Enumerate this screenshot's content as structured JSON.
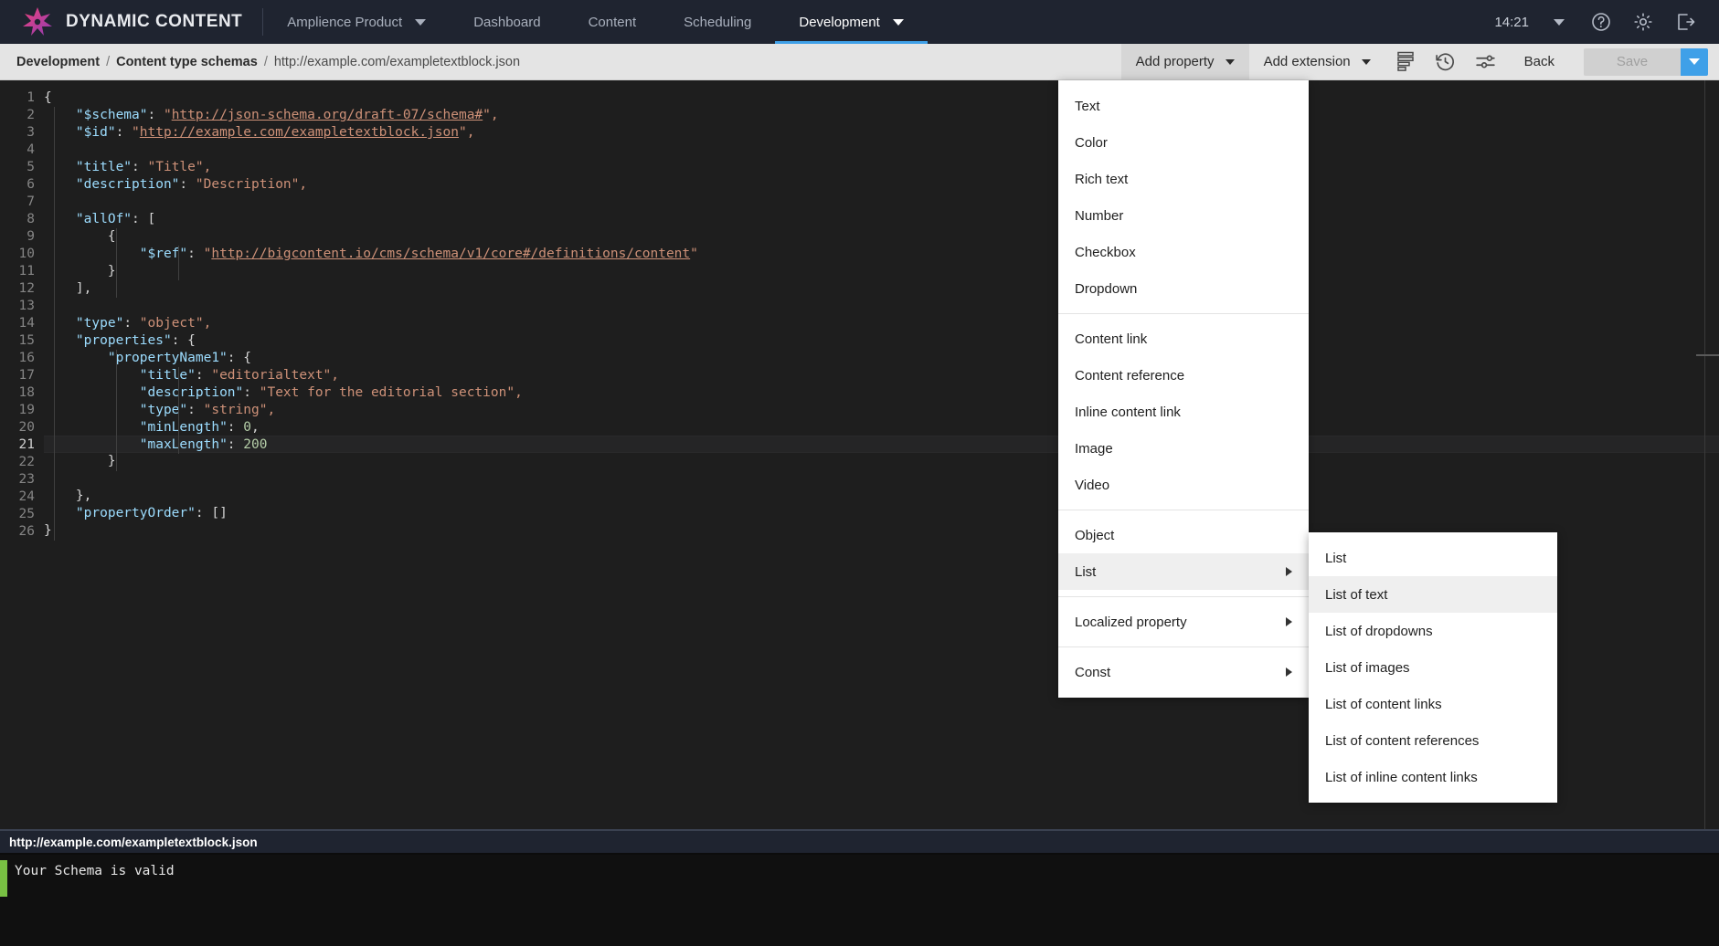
{
  "topnav": {
    "brand": "DYNAMIC CONTENT",
    "logo_icon": "amplience-star-logo",
    "product_selector": {
      "label": "Amplience Product",
      "icon": "chevron-down-icon"
    },
    "items": [
      {
        "label": "Dashboard",
        "active": false
      },
      {
        "label": "Content",
        "active": false
      },
      {
        "label": "Scheduling",
        "active": false
      },
      {
        "label": "Development",
        "active": true,
        "icon": "chevron-down-icon"
      }
    ],
    "time": "14:21",
    "time_caret_icon": "chevron-down-icon",
    "help_icon": "help-circle-icon",
    "settings_icon": "gear-icon",
    "logout_icon": "logout-icon"
  },
  "toolbar": {
    "breadcrumb": [
      {
        "label": "Development",
        "link": true
      },
      {
        "label": "Content type schemas",
        "link": true
      },
      {
        "label": "http://example.com/exampletextblock.json",
        "link": false
      }
    ],
    "breadcrumb_separator": "/",
    "add_property": {
      "label": "Add property",
      "icon": "chevron-down-icon",
      "pressed": true
    },
    "add_extension": {
      "label": "Add extension",
      "icon": "chevron-down-icon",
      "pressed": false
    },
    "icons": [
      {
        "name": "format-lines-icon"
      },
      {
        "name": "history-clock-icon"
      },
      {
        "name": "settings-sliders-icon"
      }
    ],
    "back_label": "Back",
    "save_label": "Save",
    "save_disabled": true,
    "save_dropdown_icon": "chevron-down-icon",
    "accent_color": "#3fa0e8"
  },
  "editor": {
    "language": "json",
    "active_line": 21,
    "total_lines": 26,
    "lines": [
      {
        "n": 1,
        "tokens": [
          {
            "t": "{",
            "c": "p"
          }
        ]
      },
      {
        "n": 2,
        "tokens": [
          {
            "t": "    ",
            "c": "p"
          },
          {
            "t": "\"$schema\"",
            "c": "k"
          },
          {
            "t": ": ",
            "c": "p"
          },
          {
            "t": "\"",
            "c": "s"
          },
          {
            "t": "http://json-schema.org/draft-07/schema#",
            "c": "u"
          },
          {
            "t": "\",",
            "c": "s"
          }
        ]
      },
      {
        "n": 3,
        "tokens": [
          {
            "t": "    ",
            "c": "p"
          },
          {
            "t": "\"$id\"",
            "c": "k"
          },
          {
            "t": ": ",
            "c": "p"
          },
          {
            "t": "\"",
            "c": "s"
          },
          {
            "t": "http://example.com/exampletextblock.json",
            "c": "u"
          },
          {
            "t": "\",",
            "c": "s"
          }
        ]
      },
      {
        "n": 4,
        "tokens": []
      },
      {
        "n": 5,
        "tokens": [
          {
            "t": "    ",
            "c": "p"
          },
          {
            "t": "\"title\"",
            "c": "k"
          },
          {
            "t": ": ",
            "c": "p"
          },
          {
            "t": "\"Title\",",
            "c": "s"
          }
        ]
      },
      {
        "n": 6,
        "tokens": [
          {
            "t": "    ",
            "c": "p"
          },
          {
            "t": "\"description\"",
            "c": "k"
          },
          {
            "t": ": ",
            "c": "p"
          },
          {
            "t": "\"Description\",",
            "c": "s"
          }
        ]
      },
      {
        "n": 7,
        "tokens": []
      },
      {
        "n": 8,
        "tokens": [
          {
            "t": "    ",
            "c": "p"
          },
          {
            "t": "\"allOf\"",
            "c": "k"
          },
          {
            "t": ": [",
            "c": "p"
          }
        ]
      },
      {
        "n": 9,
        "tokens": [
          {
            "t": "        {",
            "c": "p"
          }
        ]
      },
      {
        "n": 10,
        "tokens": [
          {
            "t": "            ",
            "c": "p"
          },
          {
            "t": "\"$ref\"",
            "c": "k"
          },
          {
            "t": ": ",
            "c": "p"
          },
          {
            "t": "\"",
            "c": "s"
          },
          {
            "t": "http://bigcontent.io/cms/schema/v1/core#/definitions/content",
            "c": "u"
          },
          {
            "t": "\"",
            "c": "s"
          }
        ]
      },
      {
        "n": 11,
        "tokens": [
          {
            "t": "        }",
            "c": "p"
          }
        ]
      },
      {
        "n": 12,
        "tokens": [
          {
            "t": "    ],",
            "c": "p"
          }
        ]
      },
      {
        "n": 13,
        "tokens": []
      },
      {
        "n": 14,
        "tokens": [
          {
            "t": "    ",
            "c": "p"
          },
          {
            "t": "\"type\"",
            "c": "k"
          },
          {
            "t": ": ",
            "c": "p"
          },
          {
            "t": "\"object\",",
            "c": "s"
          }
        ]
      },
      {
        "n": 15,
        "tokens": [
          {
            "t": "    ",
            "c": "p"
          },
          {
            "t": "\"properties\"",
            "c": "k"
          },
          {
            "t": ": {",
            "c": "p"
          }
        ]
      },
      {
        "n": 16,
        "tokens": [
          {
            "t": "        ",
            "c": "p"
          },
          {
            "t": "\"propertyName1\"",
            "c": "k"
          },
          {
            "t": ": {",
            "c": "p"
          }
        ]
      },
      {
        "n": 17,
        "tokens": [
          {
            "t": "            ",
            "c": "p"
          },
          {
            "t": "\"title\"",
            "c": "k"
          },
          {
            "t": ": ",
            "c": "p"
          },
          {
            "t": "\"editorialtext\",",
            "c": "s"
          }
        ]
      },
      {
        "n": 18,
        "tokens": [
          {
            "t": "            ",
            "c": "p"
          },
          {
            "t": "\"description\"",
            "c": "k"
          },
          {
            "t": ": ",
            "c": "p"
          },
          {
            "t": "\"Text for the editorial section\",",
            "c": "s"
          }
        ]
      },
      {
        "n": 19,
        "tokens": [
          {
            "t": "            ",
            "c": "p"
          },
          {
            "t": "\"type\"",
            "c": "k"
          },
          {
            "t": ": ",
            "c": "p"
          },
          {
            "t": "\"string\",",
            "c": "s"
          }
        ]
      },
      {
        "n": 20,
        "tokens": [
          {
            "t": "            ",
            "c": "p"
          },
          {
            "t": "\"minLength\"",
            "c": "k"
          },
          {
            "t": ": ",
            "c": "p"
          },
          {
            "t": "0",
            "c": "n"
          },
          {
            "t": ",",
            "c": "p"
          }
        ]
      },
      {
        "n": 21,
        "tokens": [
          {
            "t": "            ",
            "c": "p"
          },
          {
            "t": "\"maxLength\"",
            "c": "k"
          },
          {
            "t": ": ",
            "c": "p"
          },
          {
            "t": "200",
            "c": "n"
          }
        ]
      },
      {
        "n": 22,
        "tokens": [
          {
            "t": "        }",
            "c": "p"
          }
        ]
      },
      {
        "n": 23,
        "tokens": []
      },
      {
        "n": 24,
        "tokens": [
          {
            "t": "    },",
            "c": "p"
          }
        ]
      },
      {
        "n": 25,
        "tokens": [
          {
            "t": "    ",
            "c": "p"
          },
          {
            "t": "\"propertyOrder\"",
            "c": "k"
          },
          {
            "t": ": []",
            "c": "p"
          }
        ]
      },
      {
        "n": 26,
        "tokens": [
          {
            "t": "}",
            "c": "p"
          }
        ]
      }
    ]
  },
  "status": {
    "url": "http://example.com/exampletextblock.json",
    "message": "Your Schema is valid",
    "valid_color": "#78c043"
  },
  "menu_main": {
    "items": [
      {
        "label": "Text"
      },
      {
        "label": "Color"
      },
      {
        "label": "Rich text"
      },
      {
        "label": "Number"
      },
      {
        "label": "Checkbox"
      },
      {
        "label": "Dropdown"
      },
      {
        "divider": true
      },
      {
        "label": "Content link"
      },
      {
        "label": "Content reference"
      },
      {
        "label": "Inline content link"
      },
      {
        "label": "Image"
      },
      {
        "label": "Video"
      },
      {
        "divider": true
      },
      {
        "label": "Object"
      },
      {
        "label": "List",
        "submenu": true,
        "highlighted": true,
        "icon": "chevron-right-icon"
      },
      {
        "divider": true
      },
      {
        "label": "Localized property",
        "submenu": true,
        "icon": "chevron-right-icon"
      },
      {
        "divider": true
      },
      {
        "label": "Const",
        "submenu": true,
        "icon": "chevron-right-icon"
      }
    ]
  },
  "menu_sub": {
    "items": [
      {
        "label": "List"
      },
      {
        "label": "List of text",
        "highlighted": true
      },
      {
        "label": "List of dropdowns"
      },
      {
        "label": "List of images"
      },
      {
        "label": "List of content links"
      },
      {
        "label": "List of content references"
      },
      {
        "label": "List of inline content links"
      }
    ]
  }
}
